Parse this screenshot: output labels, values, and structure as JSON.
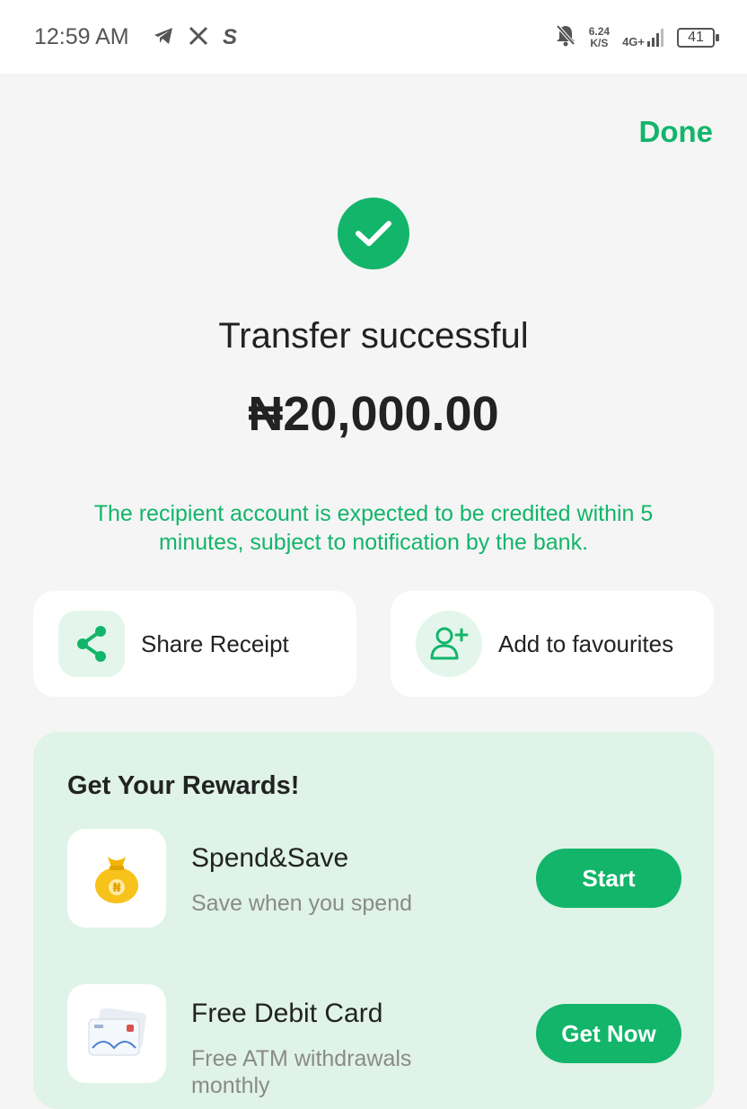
{
  "status_bar": {
    "time": "12:59 AM",
    "net_speed_value": "6.24",
    "net_speed_unit": "K/S",
    "network_type": "4G+",
    "battery": "41"
  },
  "header": {
    "done_label": "Done"
  },
  "result": {
    "title": "Transfer successful",
    "amount": "₦20,000.00",
    "notice": "The recipient account is expected to be credited within 5 minutes, subject to notification by the bank."
  },
  "actions": {
    "share_label": "Share Receipt",
    "favourite_label": "Add to favourites"
  },
  "rewards": {
    "title": "Get Your Rewards!",
    "items": [
      {
        "title": "Spend&Save",
        "subtitle": "Save when you spend",
        "button": "Start"
      },
      {
        "title": "Free Debit Card",
        "subtitle": "Free ATM withdrawals monthly",
        "button": "Get Now"
      }
    ]
  },
  "colors": {
    "accent": "#12b56a",
    "rewards_bg": "#dff3e8",
    "icon_bg": "#e4f6ec"
  },
  "icons": [
    "telegram-icon",
    "x-icon",
    "s-app-icon",
    "bell-off-icon",
    "signal-icon",
    "battery-icon",
    "check-icon",
    "share-icon",
    "add-user-icon",
    "money-bag-icon",
    "debit-card-icon"
  ]
}
